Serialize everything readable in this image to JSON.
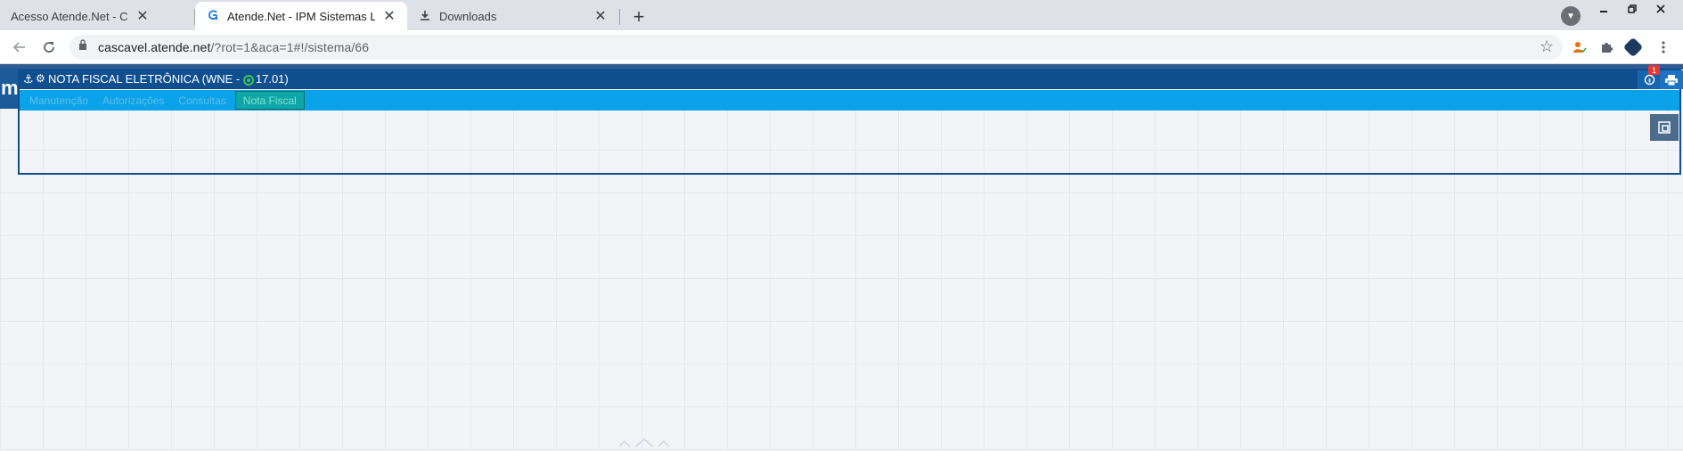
{
  "browser": {
    "tabs": [
      {
        "title": "Acesso Atende.Net - Cascavel/PR",
        "active": false
      },
      {
        "title": "Atende.Net - IPM Sistemas Ltda",
        "active": true
      },
      {
        "title": "Downloads",
        "active": false
      }
    ],
    "close_glyph": "✕",
    "new_tab_glyph": "+",
    "url_host": "cascavel.atende.net",
    "url_rest": "/?rot=1&aca=1#!/sistema/66",
    "icons": {
      "back": "back-arrow-icon",
      "reload": "reload-icon",
      "lock": "lock-icon",
      "star": "star-icon",
      "profile": "profile-extension-icon",
      "extensions": "puzzle-icon",
      "menu": "kebab-menu-icon"
    }
  },
  "app": {
    "logo_text": "m",
    "window_title": "NOTA FISCAL ELETRÔNICA (WNE - ",
    "window_version": "17.01)",
    "notification_count": "1",
    "menu": [
      {
        "label": "Manutenção"
      },
      {
        "label": "Autorizações"
      },
      {
        "label": "Consultas"
      },
      {
        "label": "Nota Fiscal",
        "active": true
      }
    ]
  },
  "colors": {
    "header_blue": "#0f4f90",
    "menu_cyan": "#0aa3e9",
    "active_teal": "#10a6a7",
    "badge_red": "#e53935"
  }
}
